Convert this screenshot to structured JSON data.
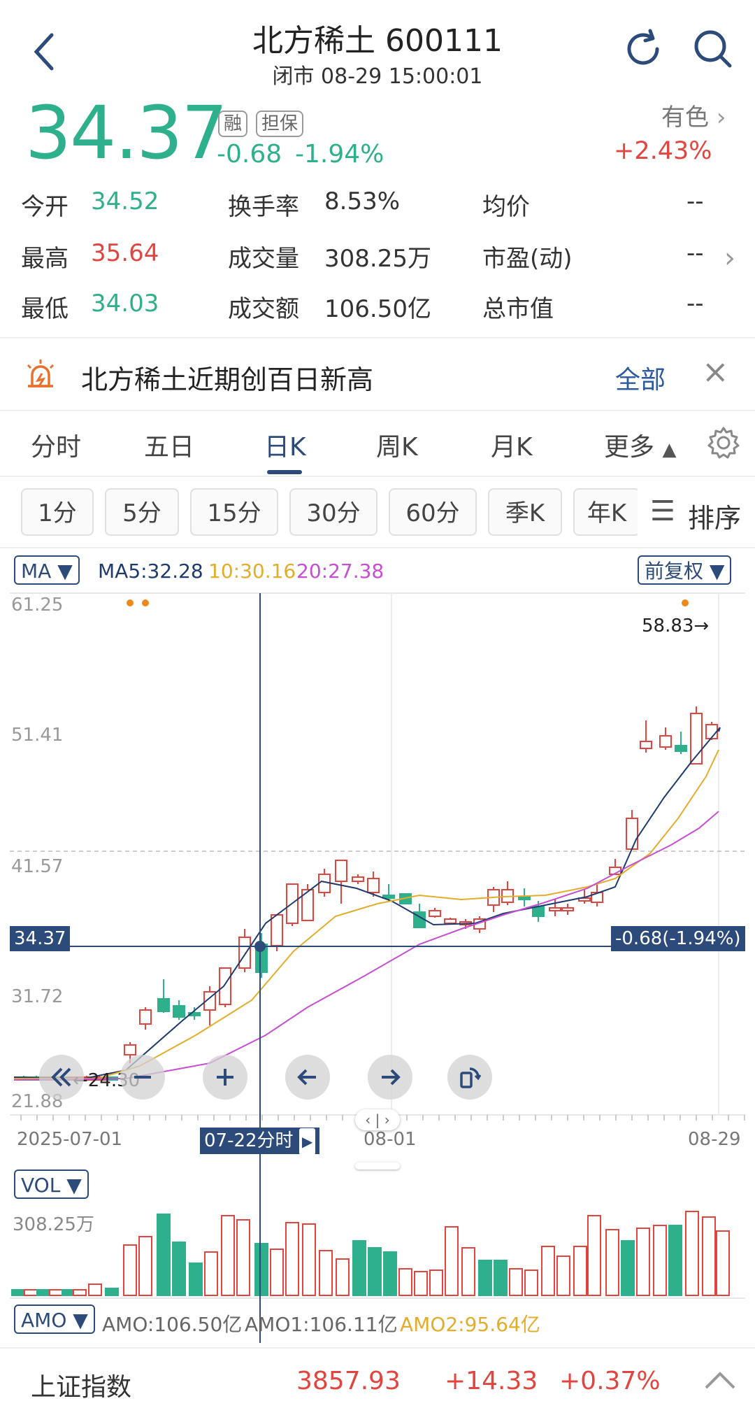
{
  "header": {
    "title": "北方稀土 600111",
    "subtitle": "闭市 08-29 15:00:01"
  },
  "quote": {
    "price": "34.37",
    "tag_rong": "融",
    "tag_danbao": "担保",
    "change": "-0.68",
    "change_pct": "-1.94%",
    "sector_name": "有色",
    "sector_pct": "+2.43%"
  },
  "stats": {
    "open_label": "今开",
    "open_value": "34.52",
    "high_label": "最高",
    "high_value": "35.64",
    "low_label": "最低",
    "low_value": "34.03",
    "turnover_label": "换手率",
    "turnover_value": "8.53%",
    "volume_label": "成交量",
    "volume_value": "308.25万",
    "amount_label": "成交额",
    "amount_value": "106.50亿",
    "avg_label": "均价",
    "avg_value": "--",
    "pe_label": "市盈(动)",
    "pe_value": "--",
    "mcap_label": "总市值",
    "mcap_value": "--"
  },
  "alert": {
    "text": "北方稀土近期创百日新高",
    "link": "全部"
  },
  "tabs": [
    "分时",
    "五日",
    "日K",
    "周K",
    "月K",
    "更多"
  ],
  "active_tab": "日K",
  "periods": [
    "1分",
    "5分",
    "15分",
    "30分",
    "60分",
    "季K",
    "年K"
  ],
  "sort_label": "排序",
  "chart": {
    "ma_selector": "MA",
    "ma5": "MA5:32.28",
    "ma10": "10:30.16",
    "ma20": "20:27.38",
    "adjust": "前复权",
    "y_labels": [
      "61.25",
      "51.41",
      "41.57",
      "31.72",
      "21.88"
    ],
    "high_marker": "58.83→",
    "low_marker": "←24.30",
    "price_tag": "34.37",
    "change_tag": "-0.68(-1.94%)",
    "x_start": "2025-07-01",
    "x_mid": "08-01",
    "x_end": "08-29",
    "cursor_label": "07-22分时",
    "vol_selector": "VOL",
    "vol_max": "308.25万",
    "amo_selector": "AMO",
    "amo": "AMO:106.50亿",
    "amo1": "AMO1:106.11亿",
    "amo2": "AMO2:95.64亿"
  },
  "footer": {
    "index_name": "上证指数",
    "index_value": "3857.93",
    "index_change": "+14.33",
    "index_pct": "+0.37%"
  },
  "colors": {
    "up": "#e0453f",
    "down": "#2fb08c",
    "accent": "#2c4a7a",
    "ma5": "#1f3b6e",
    "ma10": "#e3ad2b",
    "ma20": "#c54fd1"
  }
}
